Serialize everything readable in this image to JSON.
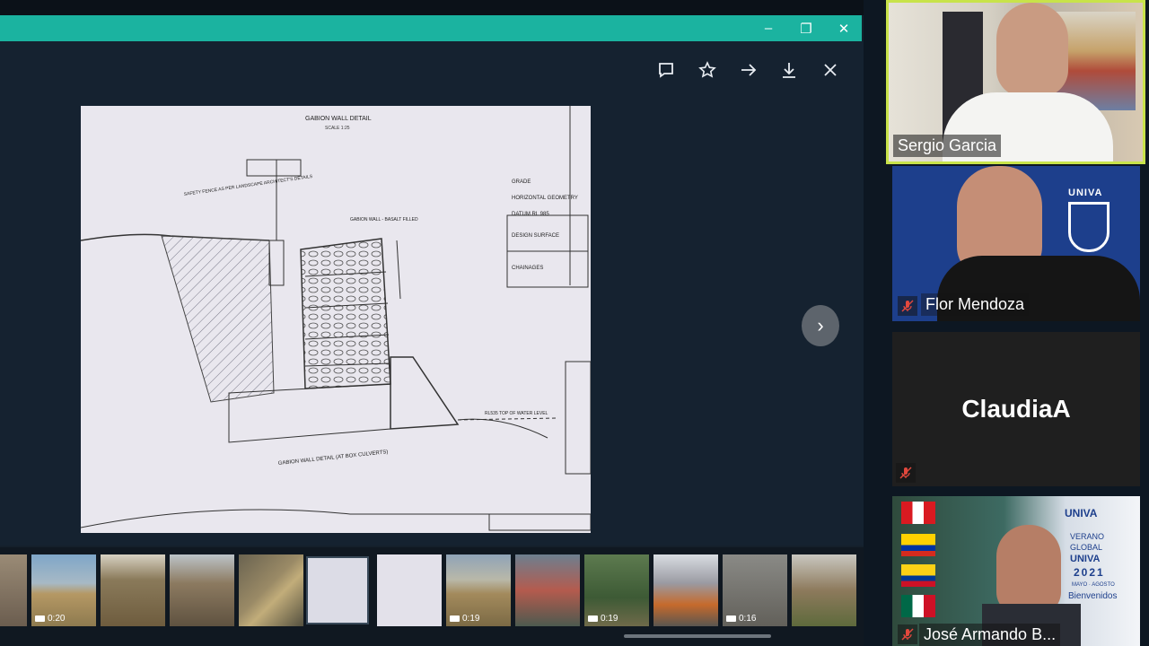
{
  "window": {
    "minimize_icon": "minimize-icon",
    "restore_icon": "restore-icon",
    "close_icon": "close-icon",
    "accent_color": "#1bb3a0"
  },
  "viewer_toolbar": [
    "comment-icon",
    "star-icon",
    "forward-icon",
    "download-icon",
    "close-icon"
  ],
  "drawing": {
    "title": "GABION WALL DETAIL",
    "subtitle": "SCALE 1:25",
    "grade": "GRADE",
    "horizontal_geometry": "HORIZONTAL GEOMETRY",
    "datum": "DATUM RL 985",
    "design_surface": "DESIGN SURFACE",
    "chainages": "CHAINAGES",
    "gabion_label": "GABION WALL - BASALT FILLED",
    "safety_fence": "SAFETY FENCE AS PER LANDSCAPE ARCHITECT'S DETAILS",
    "section_title": "GABION WALL DETAIL (AT BOX CULVERTS)",
    "water_level": "RL535 TOP OF WATER LEVEL"
  },
  "thumbnails": [
    {
      "duration": ""
    },
    {
      "duration": "0:20"
    },
    {
      "duration": ""
    },
    {
      "duration": ""
    },
    {
      "duration": ""
    },
    {
      "duration": ""
    },
    {
      "duration": ""
    },
    {
      "duration": "0:19"
    },
    {
      "duration": ""
    },
    {
      "duration": "0:19"
    },
    {
      "duration": ""
    },
    {
      "duration": "0:16"
    },
    {
      "duration": ""
    }
  ],
  "participants": [
    {
      "name": "Sergio Garcia",
      "speaking": true
    },
    {
      "name": "Flor Mendoza",
      "muted": true,
      "logo": "UNIVA"
    },
    {
      "name": "ClaudiaA",
      "muted": true
    },
    {
      "name": "José Armando B...",
      "muted": true,
      "poster": {
        "brand": "UNIVA",
        "line1": "VERANO",
        "line2": "GLOBAL",
        "line3": "UNIVA",
        "year": "2021",
        "months": "MAYO · AGOSTO",
        "welcome": "Bienvenidos"
      }
    }
  ],
  "colors": {
    "speaker_border": "#c8e34a",
    "mute_red": "#e2483d"
  }
}
